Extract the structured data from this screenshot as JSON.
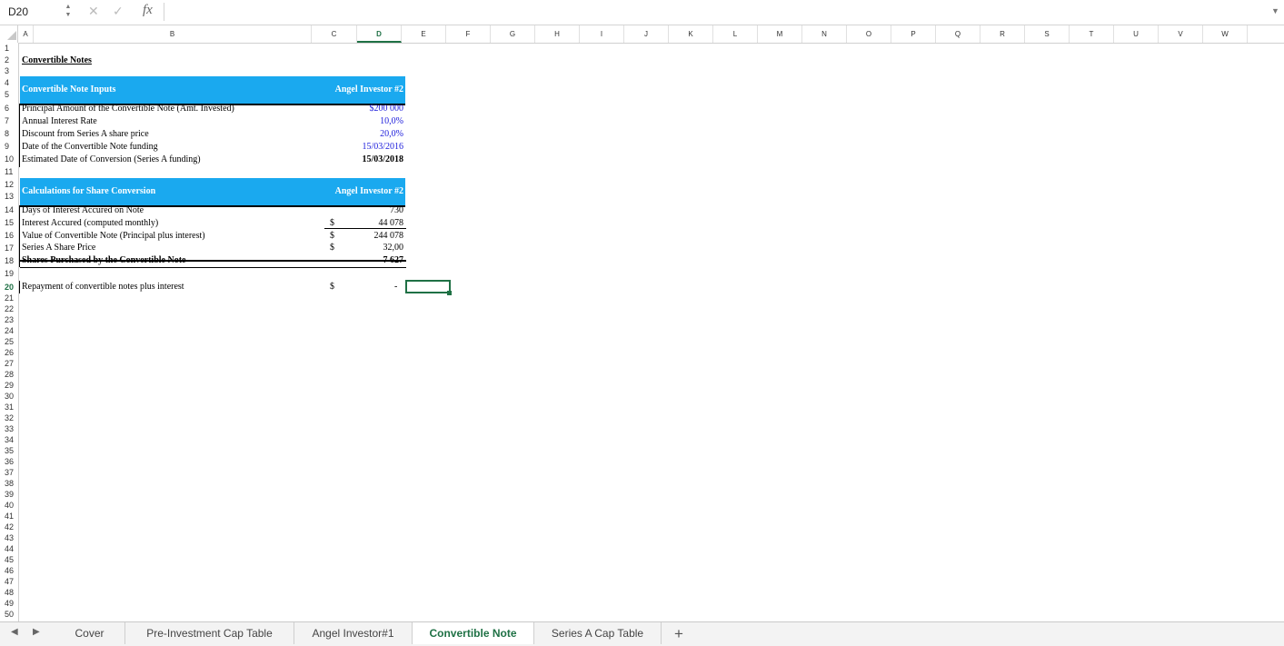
{
  "formula_bar": {
    "name_box": "D20",
    "cancel_icon": "✕",
    "confirm_icon": "✓",
    "fx_label": "fx",
    "formula": ""
  },
  "columns": [
    "A",
    "B",
    "C",
    "D",
    "E",
    "F",
    "G",
    "H",
    "I",
    "J",
    "K",
    "L",
    "M",
    "N",
    "O",
    "P",
    "Q",
    "R",
    "S",
    "T",
    "U",
    "V",
    "W"
  ],
  "selected_column": "D",
  "rows": [
    "1",
    "2",
    "3",
    "4",
    "5",
    "6",
    "7",
    "8",
    "9",
    "10",
    "11",
    "12",
    "13",
    "14",
    "15",
    "16",
    "17",
    "18",
    "19",
    "20",
    "21",
    "22",
    "23",
    "24",
    "25",
    "26",
    "27",
    "28",
    "29",
    "30",
    "31",
    "32",
    "33",
    "34",
    "35",
    "36",
    "37",
    "38",
    "39",
    "40",
    "41",
    "42",
    "43",
    "44",
    "45",
    "46",
    "47",
    "48",
    "49",
    "50"
  ],
  "selected_row": "20",
  "sheet": {
    "title": "Convertible Notes",
    "inputs_header": "Convertible Note Inputs",
    "inputs_col_header": "Angel Investor #2",
    "inputs": [
      {
        "label": "Principal Amount of the Convertible Note (Amt. Invested)",
        "value": "$200 000"
      },
      {
        "label": "Annual Interest Rate",
        "value": "10,0%"
      },
      {
        "label": "Discount from Series A share price",
        "value": "20,0%"
      },
      {
        "label": "Date of the Convertible Note funding",
        "value": "15/03/2016"
      },
      {
        "label": "Estimated Date of Conversion (Series A funding)",
        "value": "15/03/2018"
      }
    ],
    "calc_header": "Calculations for Share Conversion",
    "calc_col_header": "Angel Investor #2",
    "calcs": [
      {
        "label": "Days of Interest Accured on Note",
        "currency": "",
        "value": "730"
      },
      {
        "label": "Interest Accured (computed monthly)",
        "currency": "$",
        "value": "44 078"
      },
      {
        "label": "Value of Convertible Note (Principal plus interest)",
        "currency": "$",
        "value": "244 078"
      },
      {
        "label": "Series A Share Price",
        "currency": "$",
        "value": "32,00"
      },
      {
        "label": "Shares Purchased by the Convertible Note",
        "currency": "",
        "value": "7 627"
      }
    ],
    "repayment_label": "Repayment of convertible notes plus interest",
    "repayment_currency": "$",
    "repayment_value": "-"
  },
  "tabs": [
    "Cover",
    "Pre-Investment Cap Table",
    "Angel Investor#1",
    "Convertible Note",
    "Series A Cap Table"
  ],
  "active_tab": "Convertible Note",
  "add_tab_label": "+",
  "colors": {
    "accent_green": "#1f7145",
    "header_blue": "#1aa9ef",
    "input_blue": "#1a1adb"
  }
}
